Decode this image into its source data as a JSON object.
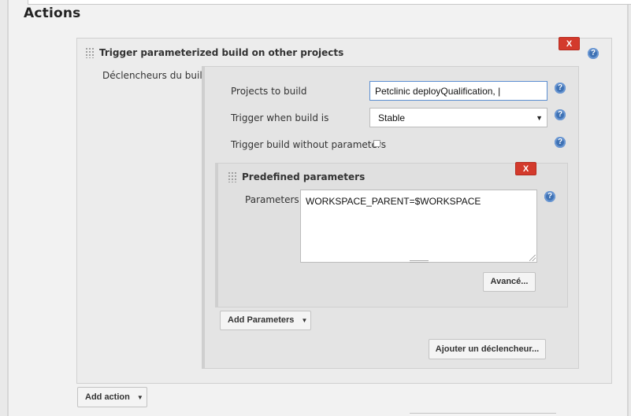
{
  "section": {
    "title": "Actions"
  },
  "trigger": {
    "title": "Trigger parameterized build on other projects",
    "delete_label": "X",
    "triggers_label": "Déclencheurs du build",
    "projects_label": "Projects to build",
    "projects_value": "Petclinic deployQualification, |",
    "trigger_when_label": "Trigger when build is",
    "trigger_when_value": "Stable",
    "without_params_label": "Trigger build without parameters",
    "without_params_checked": false,
    "add_parameters_label": "Add Parameters",
    "add_trigger_label": "Ajouter un déclencheur..."
  },
  "predefined": {
    "title": "Predefined parameters",
    "delete_label": "X",
    "parameters_label": "Parameters",
    "parameters_value": "WORKSPACE_PARENT=$WORKSPACE",
    "advanced_label": "Avancé..."
  },
  "footer": {
    "add_action_label": "Add action"
  },
  "icons": {
    "help": "?",
    "dropdown": "▼"
  },
  "colors": {
    "delete_red": "#d33a2c",
    "help_blue": "#3f72b4",
    "input_focus": "#5b8ed1"
  }
}
